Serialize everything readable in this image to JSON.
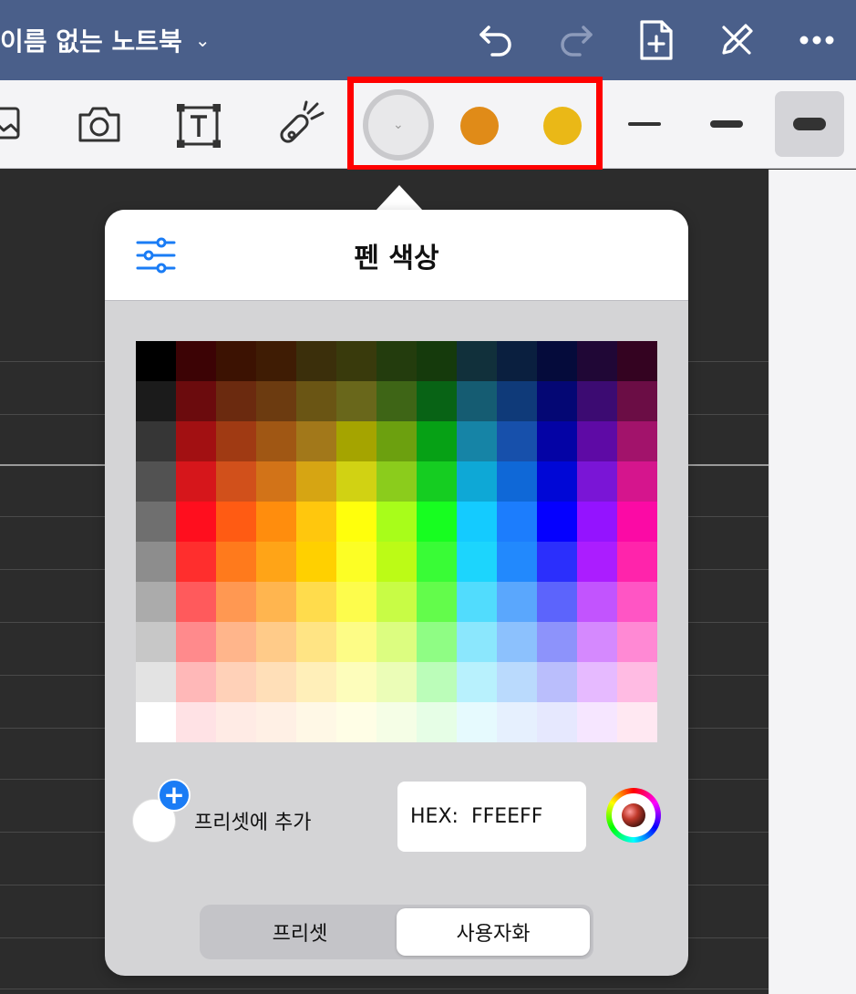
{
  "header": {
    "title": "이름 없는 노트북",
    "title_dropdown_icon": "chevron-down-icon",
    "background": "#4a5f8a",
    "icons": [
      "undo-icon",
      "redo-icon",
      "add-page-icon",
      "pen-off-icon",
      "more-icon"
    ]
  },
  "toolbar": {
    "tools": [
      "image-icon",
      "camera-icon",
      "text-box-icon",
      "laser-pointer-icon"
    ],
    "colors": [
      {
        "name": "custom-color-selected",
        "value": "#e8e8ea"
      },
      {
        "name": "orange",
        "value": "#e08b18"
      },
      {
        "name": "yellow",
        "value": "#eab817"
      }
    ],
    "highlight_color": "#ff0000",
    "stroke_widths": [
      "thin",
      "medium",
      "thick"
    ],
    "selected_stroke": "thick"
  },
  "popover": {
    "title": "펜 색상",
    "settings_icon": "sliders-icon",
    "add_preset_label": "프리셋에 추가",
    "hex_label": "HEX:",
    "hex_value": "FFEEFF",
    "color_picker_icon": "color-wheel-icon",
    "tabs": [
      {
        "label": "프리셋",
        "active": false
      },
      {
        "label": "사용자화",
        "active": true
      }
    ],
    "palette": [
      [
        "#000000",
        "#3c0305",
        "#3c1202",
        "#3f1c04",
        "#3b2f0b",
        "#393a0c",
        "#233c0d",
        "#153a0c",
        "#11303b",
        "#0a1f3f",
        "#050b3b",
        "#200736",
        "#340321"
      ],
      [
        "#1b1b1b",
        "#6b0b0d",
        "#6b2a0f",
        "#6c3b10",
        "#6a5514",
        "#69671b",
        "#3e6516",
        "#086315",
        "#155c72",
        "#0f3a79",
        "#040774",
        "#3c0b72",
        "#6b0d45"
      ],
      [
        "#363636",
        "#a21012",
        "#a03a13",
        "#a05714",
        "#a2781a",
        "#a5a400",
        "#6ca00f",
        "#06a115",
        "#1684a6",
        "#1750ab",
        "#0403a5",
        "#5e0aa5",
        "#a2136b"
      ],
      [
        "#525252",
        "#d6161b",
        "#d1501b",
        "#d27318",
        "#d6a513",
        "#d1d213",
        "#8bcc1c",
        "#15cd21",
        "#0ea8d6",
        "#0f68d7",
        "#0007d6",
        "#7a15d6",
        "#d5158d"
      ],
      [
        "#6f6f6f",
        "#ff0e1e",
        "#ff5b13",
        "#ff8d0d",
        "#ffc70d",
        "#ffff0c",
        "#a8fd1a",
        "#17fe20",
        "#14cbff",
        "#1c7dfd",
        "#0500ff",
        "#9413ff",
        "#fb0aa5"
      ],
      [
        "#8d8d8d",
        "#ff2e2d",
        "#ff7a1c",
        "#ffa417",
        "#ffd000",
        "#fcfe25",
        "#bcfb16",
        "#39fc36",
        "#1cd5fd",
        "#2289fd",
        "#2b2ffc",
        "#ab1dff",
        "#ff24ab"
      ],
      [
        "#ababab",
        "#ff5a5c",
        "#ff9852",
        "#ffb54f",
        "#ffdc4c",
        "#fdfc4c",
        "#c8fc45",
        "#63fc4b",
        "#51dcfd",
        "#5aa7fd",
        "#5c64fc",
        "#c254fe",
        "#ff55c4"
      ],
      [
        "#c7c7c7",
        "#ff8a8c",
        "#ffb58b",
        "#ffcb89",
        "#ffe484",
        "#fdfc86",
        "#dcfd80",
        "#8ffd84",
        "#8be7fd",
        "#8cc1fd",
        "#8d93fb",
        "#d589fe",
        "#ff89d4"
      ],
      [
        "#e3e3e3",
        "#ffb8b8",
        "#ffd1b8",
        "#ffdfb8",
        "#ffefb9",
        "#fdfdbb",
        "#ebfdb7",
        "#bbfdb9",
        "#b8f1fd",
        "#badafd",
        "#babefc",
        "#e6baff",
        "#ffbbe3"
      ],
      [
        "#ffffff",
        "#ffe2e5",
        "#ffebe5",
        "#fff0e5",
        "#fff8e6",
        "#fffee6",
        "#f5fee6",
        "#e6fee6",
        "#e6fafe",
        "#e6f0fe",
        "#e6e8fe",
        "#f6e6ff",
        "#ffe8f2"
      ]
    ]
  }
}
